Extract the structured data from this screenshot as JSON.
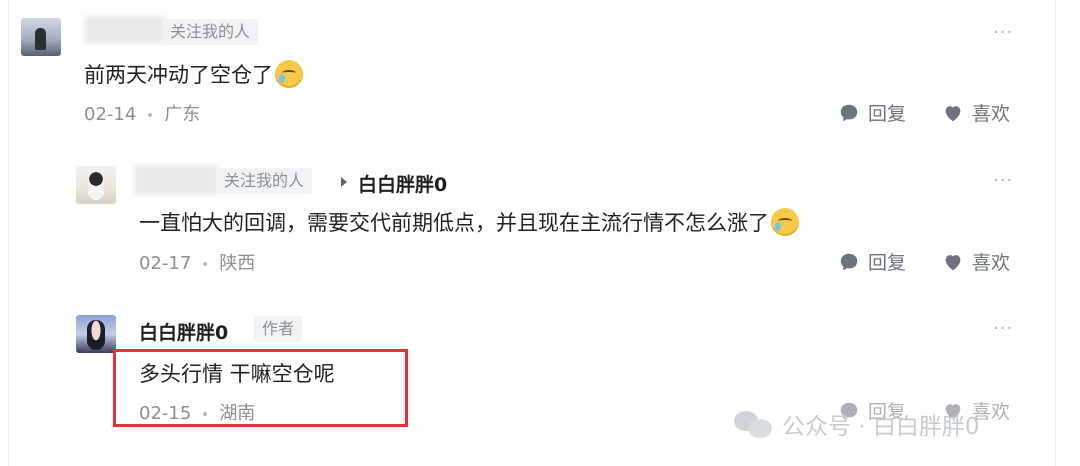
{
  "watermark": {
    "text": "公众号 · 白白胖胖0",
    "icon": "wechat-icon"
  },
  "comments": [
    {
      "author_tag": "关注我的人",
      "text": "前两天冲动了空仓了",
      "emoji": "sweat-face-emoji",
      "date": "02-14",
      "location": "广东",
      "reply_label": "回复",
      "like_label": "喜欢",
      "more": "···"
    },
    {
      "author_tag": "关注我的人",
      "reply_to": "白白胖胖0",
      "text": "一直怕大的回调，需要交代前期低点，并且现在主流行情不怎么涨了",
      "emoji": "crying-face-emoji",
      "date": "02-17",
      "location": "陕西",
      "reply_label": "回复",
      "like_label": "喜欢",
      "more": "···"
    },
    {
      "author": "白白胖胖0",
      "author_badge": "作者",
      "text": "多头行情 干嘛空仓呢",
      "date": "02-15",
      "location": "湖南",
      "reply_label": "回复",
      "like_label": "喜欢",
      "more": "···"
    }
  ],
  "colors": {
    "highlight_box": "#e23434",
    "meta": "#8a8f99",
    "action": "#6e7380"
  }
}
